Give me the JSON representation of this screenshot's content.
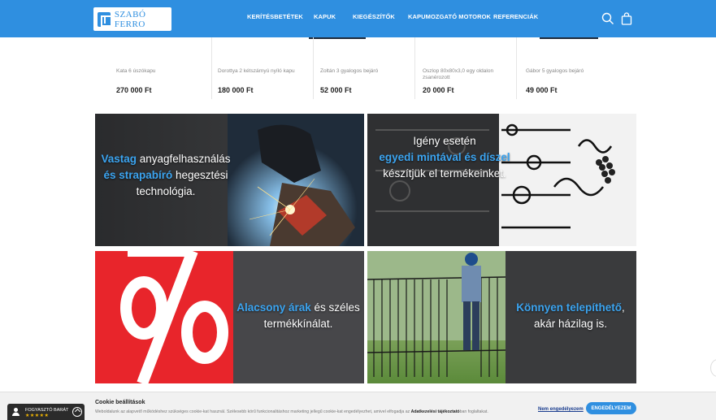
{
  "header": {
    "logo_text": "SZABÓ FERRO",
    "nav": [
      {
        "label": "KERÍTÉSBETÉTEK"
      },
      {
        "label": "KAPUK"
      },
      {
        "label": "KIEGÉSZÍTŐK"
      },
      {
        "label": "KAPUMOZGATÓ MOTOROK"
      },
      {
        "label": "REFERENCIÁK"
      }
    ],
    "icons": [
      "search-icon",
      "shopping-bag-icon"
    ],
    "brand_color": "#2f8fe0"
  },
  "products": [
    {
      "name": "Kata 6 úszókapu",
      "price": "270 000 Ft"
    },
    {
      "name": "Dorottya 2 kétszárnyú nyíló kapu",
      "price": "180 000 Ft"
    },
    {
      "name": "Zoltán 3 gyalogos bejáró",
      "price": "52 000 Ft"
    },
    {
      "name": "Oszlop 80x80x3,0 egy oldalon zsanérozott",
      "price": "20 000 Ft"
    },
    {
      "name": "Gábor 5 gyalogos bejáró",
      "price": "49 000 Ft"
    }
  ],
  "banners": [
    {
      "hl1": "Vastag",
      "t1": " anyagfelhasználás",
      "hl2": "és strapabíró",
      "t2": " hegesztési",
      "t3": "technológia."
    },
    {
      "t1": "Igény esetén",
      "hl1": "egyedi mintával és díszel",
      "t2": "készítjük el termékeinket."
    },
    {
      "hl1": "Alacsony árak",
      "t1": " és széles",
      "t2": "termékkínálat."
    },
    {
      "hl1": "Könnyen telepíthető",
      "t1": ",",
      "t2": "akár házilag is."
    }
  ],
  "cookie": {
    "title": "Cookie beállítások",
    "text": "Weboldalunk az alapvető működéshez szükséges cookie-kat használ. Szélesebb körű funkcionalitáshoz marketing jellegű cookie-kat engedélyezhet, amivel elfogadja az ",
    "link": "Adatkezelési tájékoztató",
    "text_end": "ban foglaltakat.",
    "decline": "Nem engedélyezem",
    "accept": "ENGEDÉLYEZEM"
  },
  "badge": {
    "label": "FOGYASZTÓ BARÁT",
    "stars": "★★★★★"
  }
}
